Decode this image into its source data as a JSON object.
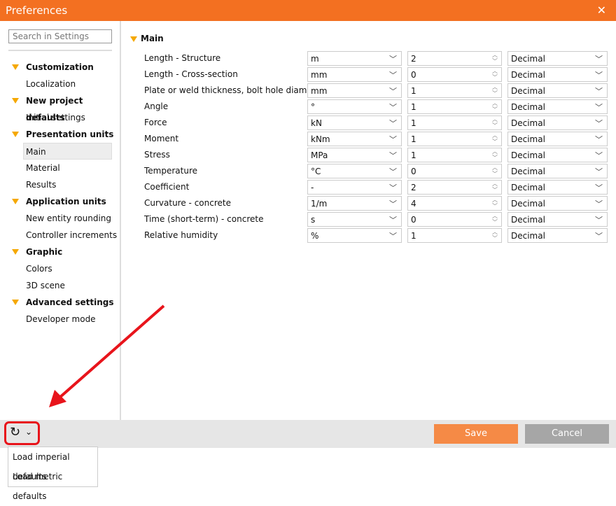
{
  "window": {
    "title": "Preferences",
    "close_icon": "close-icon"
  },
  "sidebar": {
    "search_placeholder": "Search in Settings",
    "items": [
      {
        "label": "Customization",
        "group": true
      },
      {
        "label": "Localization"
      },
      {
        "label": "New project defaults",
        "group": true
      },
      {
        "label": "Initial settings"
      },
      {
        "label": "Presentation units",
        "group": true
      },
      {
        "label": "Main",
        "selected": true
      },
      {
        "label": "Material"
      },
      {
        "label": "Results"
      },
      {
        "label": "Application units",
        "group": true
      },
      {
        "label": "New entity rounding"
      },
      {
        "label": "Controller increments"
      },
      {
        "label": "Graphic",
        "group": true
      },
      {
        "label": "Colors"
      },
      {
        "label": "3D scene"
      },
      {
        "label": "Advanced settings",
        "group": true
      },
      {
        "label": "Developer mode"
      }
    ]
  },
  "main": {
    "section": "Main",
    "rows": [
      {
        "label": "Length - Structure",
        "unit": "m",
        "precision": "2",
        "format": "Decimal"
      },
      {
        "label": "Length - Cross-section",
        "unit": "mm",
        "precision": "0",
        "format": "Decimal"
      },
      {
        "label": "Plate or weld thickness, bolt hole diameter",
        "unit": "mm",
        "precision": "1",
        "format": "Decimal"
      },
      {
        "label": "Angle",
        "unit": "°",
        "precision": "1",
        "format": "Decimal"
      },
      {
        "label": "Force",
        "unit": "kN",
        "precision": "1",
        "format": "Decimal"
      },
      {
        "label": "Moment",
        "unit": "kNm",
        "precision": "1",
        "format": "Decimal"
      },
      {
        "label": "Stress",
        "unit": "MPa",
        "precision": "1",
        "format": "Decimal"
      },
      {
        "label": "Temperature",
        "unit": "°C",
        "precision": "0",
        "format": "Decimal"
      },
      {
        "label": "Coefficient",
        "unit": "-",
        "precision": "2",
        "format": "Decimal"
      },
      {
        "label": "Curvature - concrete",
        "unit": "1/m",
        "precision": "4",
        "format": "Decimal"
      },
      {
        "label": "Time (short-term) - concrete",
        "unit": "s",
        "precision": "0",
        "format": "Decimal"
      },
      {
        "label": "Relative humidity",
        "unit": "%",
        "precision": "1",
        "format": "Decimal"
      }
    ]
  },
  "footer": {
    "save": "Save",
    "cancel": "Cancel",
    "reset_icon": "reset-icon"
  },
  "menu": {
    "items": [
      "Load imperial defaults",
      "Load metric defaults"
    ]
  },
  "colors": {
    "accent": "#f37021",
    "highlight": "#e8141b"
  }
}
